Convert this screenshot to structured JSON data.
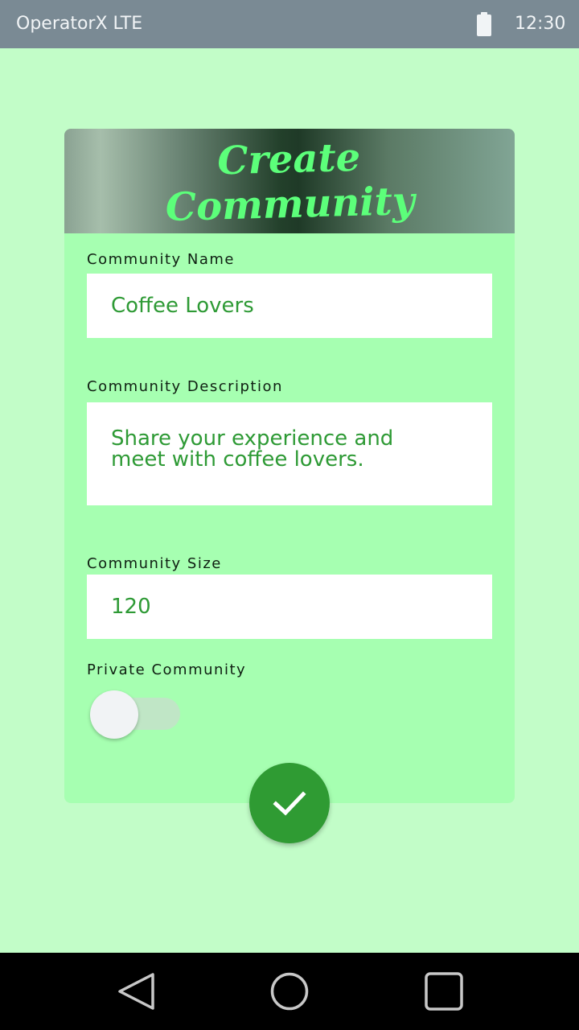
{
  "status_bar": {
    "carrier": "OperatorX LTE",
    "time": "12:30",
    "battery_icon": "battery-full-icon"
  },
  "header": {
    "title": "Create\nCommunity"
  },
  "form": {
    "name_label": "Community Name",
    "name_value": "Coffee Lovers",
    "description_label": "Community Description",
    "description_value": "Share your experience and\nmeet with coffee lovers.",
    "size_label": "Community Size",
    "size_value": "120",
    "private_label": "Private Community",
    "private_enabled": false
  },
  "submit_button": {
    "icon": "checkmark-icon"
  },
  "nav_bar": {
    "back_icon": "back-triangle-icon",
    "home_icon": "home-circle-icon",
    "recent_icon": "recent-apps-square-icon"
  },
  "colors": {
    "background": "#c2fdc8",
    "card": "#a6ffb1",
    "title": "#5cff7a",
    "value_text": "#2e9a35",
    "fab": "#2f9b33",
    "status_bar": "#7a8a94"
  }
}
